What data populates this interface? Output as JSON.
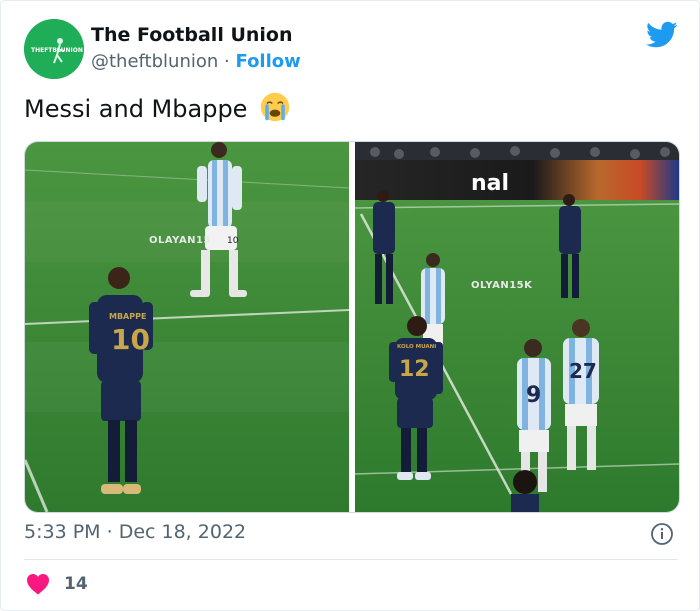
{
  "author": {
    "name": "The Football Union",
    "handle": "@theftblunion",
    "separator": "·",
    "follow_label": "Follow",
    "avatar_text": "THEFTBLUNION",
    "avatar_color": "#1fae57"
  },
  "tweet": {
    "text": "Messi and Mbappe",
    "emoji": "loudly-crying-face"
  },
  "media": {
    "left_photo": {
      "watermark": "OLAYAN15",
      "jersey_name": "MBAPPE",
      "jersey_number": "10",
      "messi_number": "10"
    },
    "right_photo": {
      "billboard_text": "nal",
      "watermark": "OLYAN15K",
      "player_name": "KOLO MUANI",
      "player_number": "12",
      "argentina_number_1": "9",
      "argentina_number_2": "27"
    }
  },
  "meta": {
    "time": "5:33 PM",
    "separator": "·",
    "date": "Dec 18, 2022"
  },
  "engagement": {
    "likes": "14"
  },
  "colors": {
    "accent": "#1d9bf0",
    "secondary_text": "#536471",
    "heart": "#f91880",
    "pitch": "#3d8a3a"
  }
}
